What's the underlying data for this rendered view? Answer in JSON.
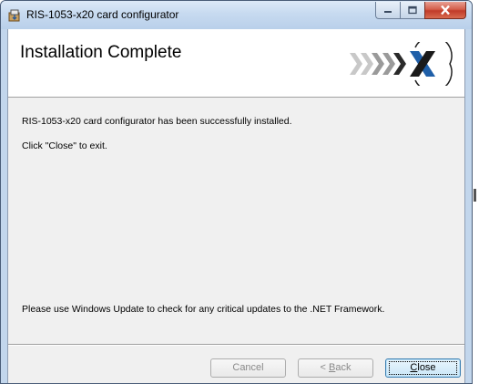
{
  "window": {
    "title": "RIS-1053-x20 card configurator",
    "icon": "installer-icon",
    "caption_buttons": [
      "minimize-icon",
      "maximize-icon",
      "close-icon"
    ]
  },
  "banner": {
    "title": "Installation Complete",
    "logo": "chevron-x-logo"
  },
  "body": {
    "message": "RIS-1053-x20 card configurator has been successfully installed.",
    "instruction": "Click \"Close\" to exit.",
    "update_note": "Please use Windows Update to check for any critical updates to the .NET Framework."
  },
  "buttons": {
    "cancel_label": "Cancel",
    "back_prefix": "< ",
    "back_mnemonic": "B",
    "back_rest": "ack",
    "close_mnemonic": "C",
    "close_rest": "lose"
  },
  "colors": {
    "title_bar": "#c7daf0",
    "close_button": "#c13b28",
    "logo_blue": "#1f5fa8",
    "dialog_bg": "#f0f0f0"
  }
}
